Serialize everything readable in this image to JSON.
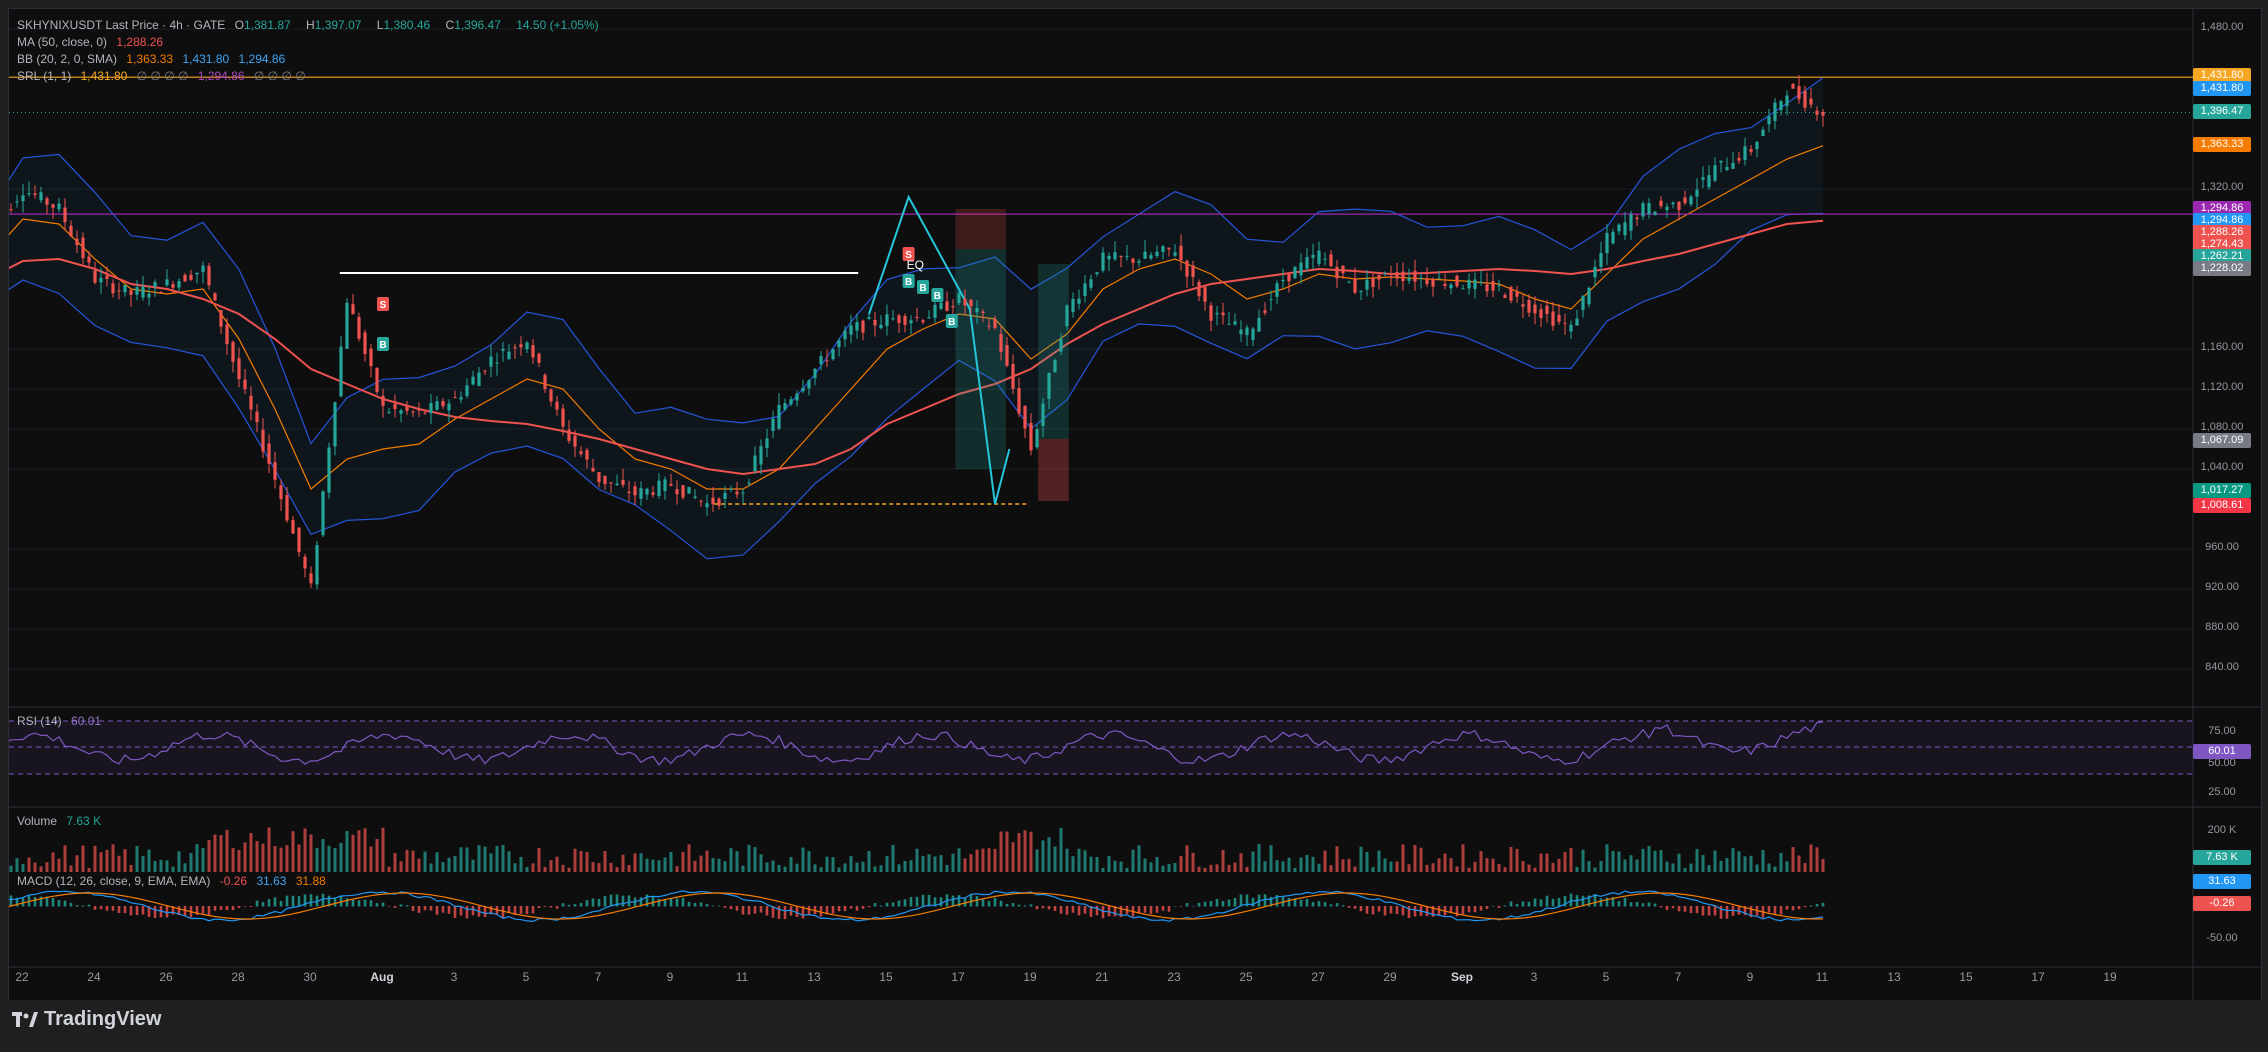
{
  "header": {
    "symbol": "SKHYNIXUSDT Last Price · 4h · GATE",
    "o_label": "O",
    "o": "1,381.87",
    "h_label": "H",
    "h": "1,397.07",
    "l_label": "L",
    "l": "1,380.46",
    "c_label": "C",
    "c": "1,396.47",
    "chg": "14.50 (+1.05%)"
  },
  "indicators": {
    "ma": {
      "label": "MA (50, close, 0)",
      "value": "1,288.26"
    },
    "bb": {
      "label": "BB (20, 2, 0, SMA)",
      "v1": "1,363.33",
      "v2": "1,431.80",
      "v3": "1,294.86"
    },
    "srl": {
      "label": "SRL (1, 1)",
      "v1": "1,431.80",
      "v1dots": "∅ ∅ ∅ ∅",
      "v2": "1,294.86",
      "v2dots": "∅ ∅ ∅ ∅"
    },
    "rsi": {
      "label": "RSI (14)",
      "value": "60.01"
    },
    "volume": {
      "label": "Volume",
      "value": "7.63 K"
    },
    "macd": {
      "label": "MACD (12, 26, close, 9, EMA, EMA)",
      "v1": "-0.26",
      "v2": "31.63",
      "v3": "31.88"
    }
  },
  "price_labels": [
    {
      "text": "1,431.80",
      "price": 1431.8,
      "color": "#f5a623"
    },
    {
      "text": "1,431.80",
      "price": 1419.0,
      "color": "#2196f3"
    },
    {
      "text": "1,396.47",
      "price": 1396.47,
      "color": "#26a69a"
    },
    {
      "text": "1,363.33",
      "price": 1363.33,
      "color": "#f57c00"
    },
    {
      "text": "1,294.86",
      "price": 1299.0,
      "color": "#9c27b0"
    },
    {
      "text": "1,294.86",
      "price": 1287.0,
      "color": "#2196f3"
    },
    {
      "text": "1,288.26",
      "price": 1275.0,
      "color": "#ef5350"
    },
    {
      "text": "1,274.43",
      "price": 1263.0,
      "color": "#ef5350"
    },
    {
      "text": "1,262.21",
      "price": 1251.0,
      "color": "#26a69a"
    },
    {
      "text": "1,228.02",
      "price": 1239.0,
      "color": "#787b86"
    },
    {
      "text": "1,067.09",
      "price": 1067.09,
      "color": "#787b86"
    },
    {
      "text": "1,017.27",
      "price": 1017.27,
      "color": "#089981"
    },
    {
      "text": "1,008.61",
      "price": 1002.0,
      "color": "#f23645"
    }
  ],
  "y_ticks": [
    "1,480.00",
    "1,320.00",
    "1,160.00",
    "1,120.00",
    "1,080.00",
    "1,040.00",
    "960.00",
    "920.00",
    "880.00",
    "840.00"
  ],
  "y_tick_values": [
    1480,
    1320,
    1160,
    1120,
    1080,
    1040,
    960,
    920,
    880,
    840
  ],
  "rsi_ticks": [
    "75.00",
    "50.00",
    "25.00"
  ],
  "rsi_value_label": "60.01",
  "volume_tick": "200 K",
  "volume_value_label": "7.63 K",
  "macd_labels": {
    "v2": "31.63",
    "v1": "-0.26",
    "tick": "-50.00"
  },
  "x_ticks": [
    {
      "label": "22",
      "bold": false
    },
    {
      "label": "24",
      "bold": false
    },
    {
      "label": "26",
      "bold": false
    },
    {
      "label": "28",
      "bold": false
    },
    {
      "label": "30",
      "bold": false
    },
    {
      "label": "Aug",
      "bold": true
    },
    {
      "label": "3",
      "bold": false
    },
    {
      "label": "5",
      "bold": false
    },
    {
      "label": "7",
      "bold": false
    },
    {
      "label": "9",
      "bold": false
    },
    {
      "label": "11",
      "bold": false
    },
    {
      "label": "13",
      "bold": false
    },
    {
      "label": "15",
      "bold": false
    },
    {
      "label": "17",
      "bold": false
    },
    {
      "label": "19",
      "bold": false
    },
    {
      "label": "21",
      "bold": false
    },
    {
      "label": "23",
      "bold": false
    },
    {
      "label": "25",
      "bold": false
    },
    {
      "label": "27",
      "bold": false
    },
    {
      "label": "29",
      "bold": false
    },
    {
      "label": "Sep",
      "bold": true
    },
    {
      "label": "3",
      "bold": false
    },
    {
      "label": "5",
      "bold": false
    },
    {
      "label": "7",
      "bold": false
    },
    {
      "label": "9",
      "bold": false
    },
    {
      "label": "11",
      "bold": false
    },
    {
      "label": "13",
      "bold": false
    },
    {
      "label": "15",
      "bold": false
    },
    {
      "label": "17",
      "bold": false
    },
    {
      "label": "19",
      "bold": false
    }
  ],
  "annotations": {
    "eq": "EQ",
    "s": "S",
    "b": "B"
  },
  "brand": "TradingView",
  "colors": {
    "up": "#26a69a",
    "down": "#ef5350",
    "ma": "#ef5350",
    "bb_basis": "#f57c00",
    "bb_band": "#2962ff",
    "srl_top": "#f5a623",
    "srl_mid": "#9c27b0",
    "rsi": "#7e57c2"
  },
  "chart_data": {
    "type": "line",
    "title": "SKHYNIXUSDT Last Price · 4h · GATE",
    "x": [
      "Jul 21",
      "Jul 22",
      "Jul 23",
      "Jul 24",
      "Jul 25",
      "Jul 26",
      "Jul 27",
      "Jul 28",
      "Jul 29",
      "Jul 30",
      "Jul 31",
      "Aug 1",
      "Aug 2",
      "Aug 3",
      "Aug 4",
      "Aug 5",
      "Aug 6",
      "Aug 7",
      "Aug 8",
      "Aug 9",
      "Aug 10",
      "Aug 11",
      "Aug 12",
      "Aug 13",
      "Aug 14",
      "Aug 15",
      "Aug 16",
      "Aug 17",
      "Aug 18",
      "Aug 19",
      "Aug 20",
      "Aug 21",
      "Aug 22",
      "Aug 23",
      "Aug 24",
      "Aug 25",
      "Aug 26",
      "Aug 27",
      "Aug 28",
      "Aug 29",
      "Aug 30",
      "Aug 31",
      "Sep 1",
      "Sep 2",
      "Sep 3",
      "Sep 4",
      "Sep 5",
      "Sep 6",
      "Sep 7",
      "Sep 8",
      "Sep 9",
      "Sep 10"
    ],
    "series": [
      {
        "name": "Close",
        "values": [
          1275,
          1320,
          1300,
          1230,
          1215,
          1225,
          1240,
          1130,
          1030,
          920,
          1210,
          1100,
          1095,
          1110,
          1150,
          1170,
          1080,
          1030,
          1015,
          1025,
          1005,
          1020,
          1100,
          1140,
          1180,
          1190,
          1192,
          1210,
          1180,
          1060,
          1200,
          1250,
          1250,
          1260,
          1195,
          1175,
          1230,
          1255,
          1220,
          1235,
          1230,
          1225,
          1220,
          1200,
          1180,
          1270,
          1300,
          1305,
          1340,
          1360,
          1420,
          1396.47
        ]
      },
      {
        "name": "MA (50, close, 0)",
        "values": [
          1230,
          1248,
          1250,
          1240,
          1225,
          1220,
          1210,
          1195,
          1170,
          1140,
          1125,
          1110,
          1100,
          1092,
          1088,
          1085,
          1078,
          1070,
          1060,
          1050,
          1040,
          1035,
          1040,
          1045,
          1060,
          1085,
          1100,
          1115,
          1125,
          1140,
          1165,
          1185,
          1200,
          1215,
          1225,
          1230,
          1235,
          1240,
          1238,
          1235,
          1236,
          1238,
          1240,
          1238,
          1235,
          1240,
          1248,
          1255,
          1265,
          1275,
          1285,
          1288.26
        ]
      },
      {
        "name": "BB (20, 2, 0, SMA)",
        "values": [
          1250,
          1290,
          1285,
          1250,
          1220,
          1215,
          1220,
          1170,
          1100,
          1020,
          1050,
          1060,
          1065,
          1090,
          1110,
          1130,
          1120,
          1080,
          1050,
          1040,
          1020,
          1020,
          1040,
          1080,
          1120,
          1160,
          1180,
          1195,
          1190,
          1150,
          1175,
          1220,
          1240,
          1250,
          1235,
          1210,
          1220,
          1235,
          1230,
          1232,
          1230,
          1228,
          1225,
          1210,
          1200,
          1235,
          1270,
          1290,
          1310,
          1330,
          1350,
          1363.33
        ]
      }
    ],
    "ylim": [
      800,
      1500
    ]
  }
}
